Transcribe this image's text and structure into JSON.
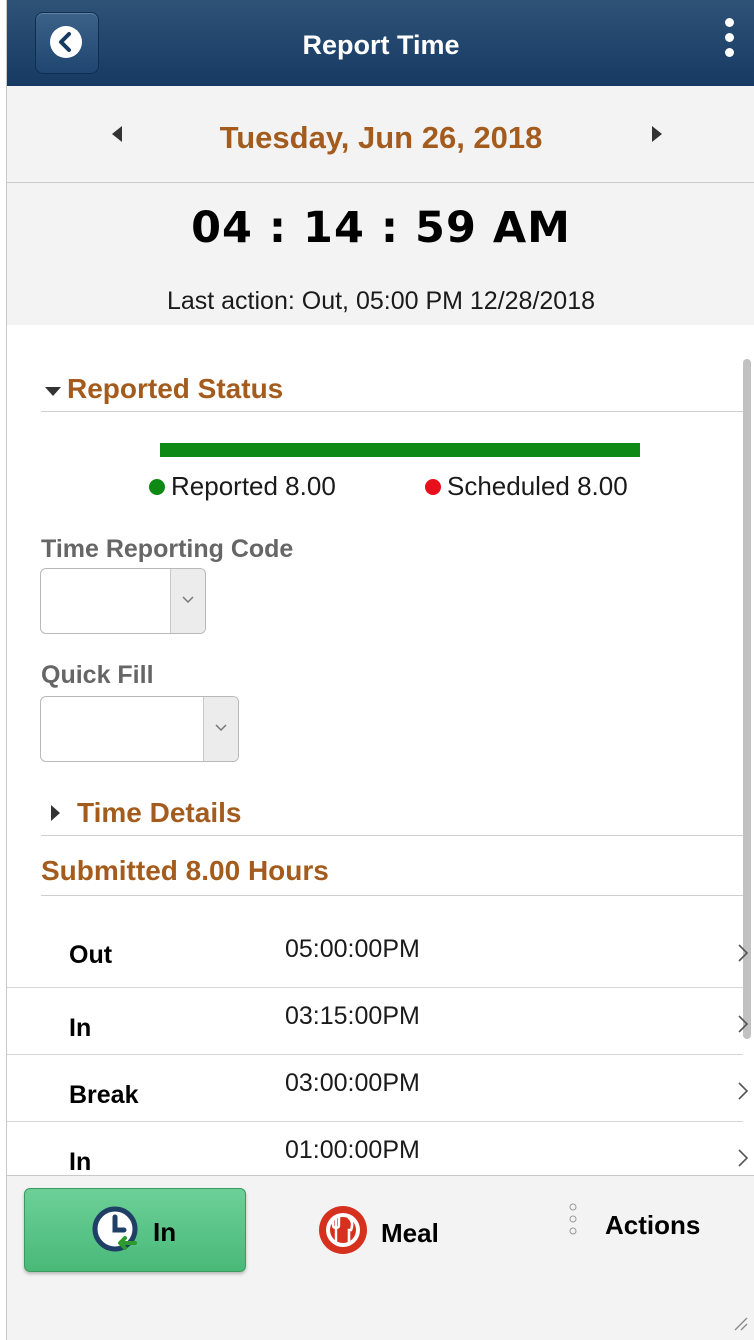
{
  "header": {
    "title": "Report Time"
  },
  "date_nav": {
    "date": "Tuesday, Jun 26, 2018"
  },
  "clock": {
    "time": "04 : 14 : 59 AM",
    "last_action": "Last action: Out, 05:00 PM 12/28/2018"
  },
  "reported_status": {
    "title": "Reported Status",
    "reported_label": "Reported 8.00",
    "scheduled_label": "Scheduled 8.00",
    "reported_color": "#0e8a14",
    "scheduled_color": "#e8101b",
    "reported_fraction": 1.0
  },
  "fields": {
    "trc_label": "Time Reporting Code",
    "trc_value": "",
    "quick_fill_label": "Quick Fill",
    "quick_fill_value": ""
  },
  "time_details": {
    "title": "Time Details"
  },
  "submitted": {
    "title": "Submitted 8.00 Hours",
    "rows": [
      {
        "label": "Out",
        "time": "05:00:00PM"
      },
      {
        "label": "In",
        "time": "03:15:00PM"
      },
      {
        "label": "Break",
        "time": "03:00:00PM"
      },
      {
        "label": "In",
        "time": "01:00:00PM"
      }
    ]
  },
  "footer": {
    "in_label": "In",
    "meal_label": "Meal",
    "actions_label": "Actions"
  },
  "colors": {
    "header": "#1f4670",
    "accent": "#a35c1d",
    "in_button": "#5cc489"
  }
}
